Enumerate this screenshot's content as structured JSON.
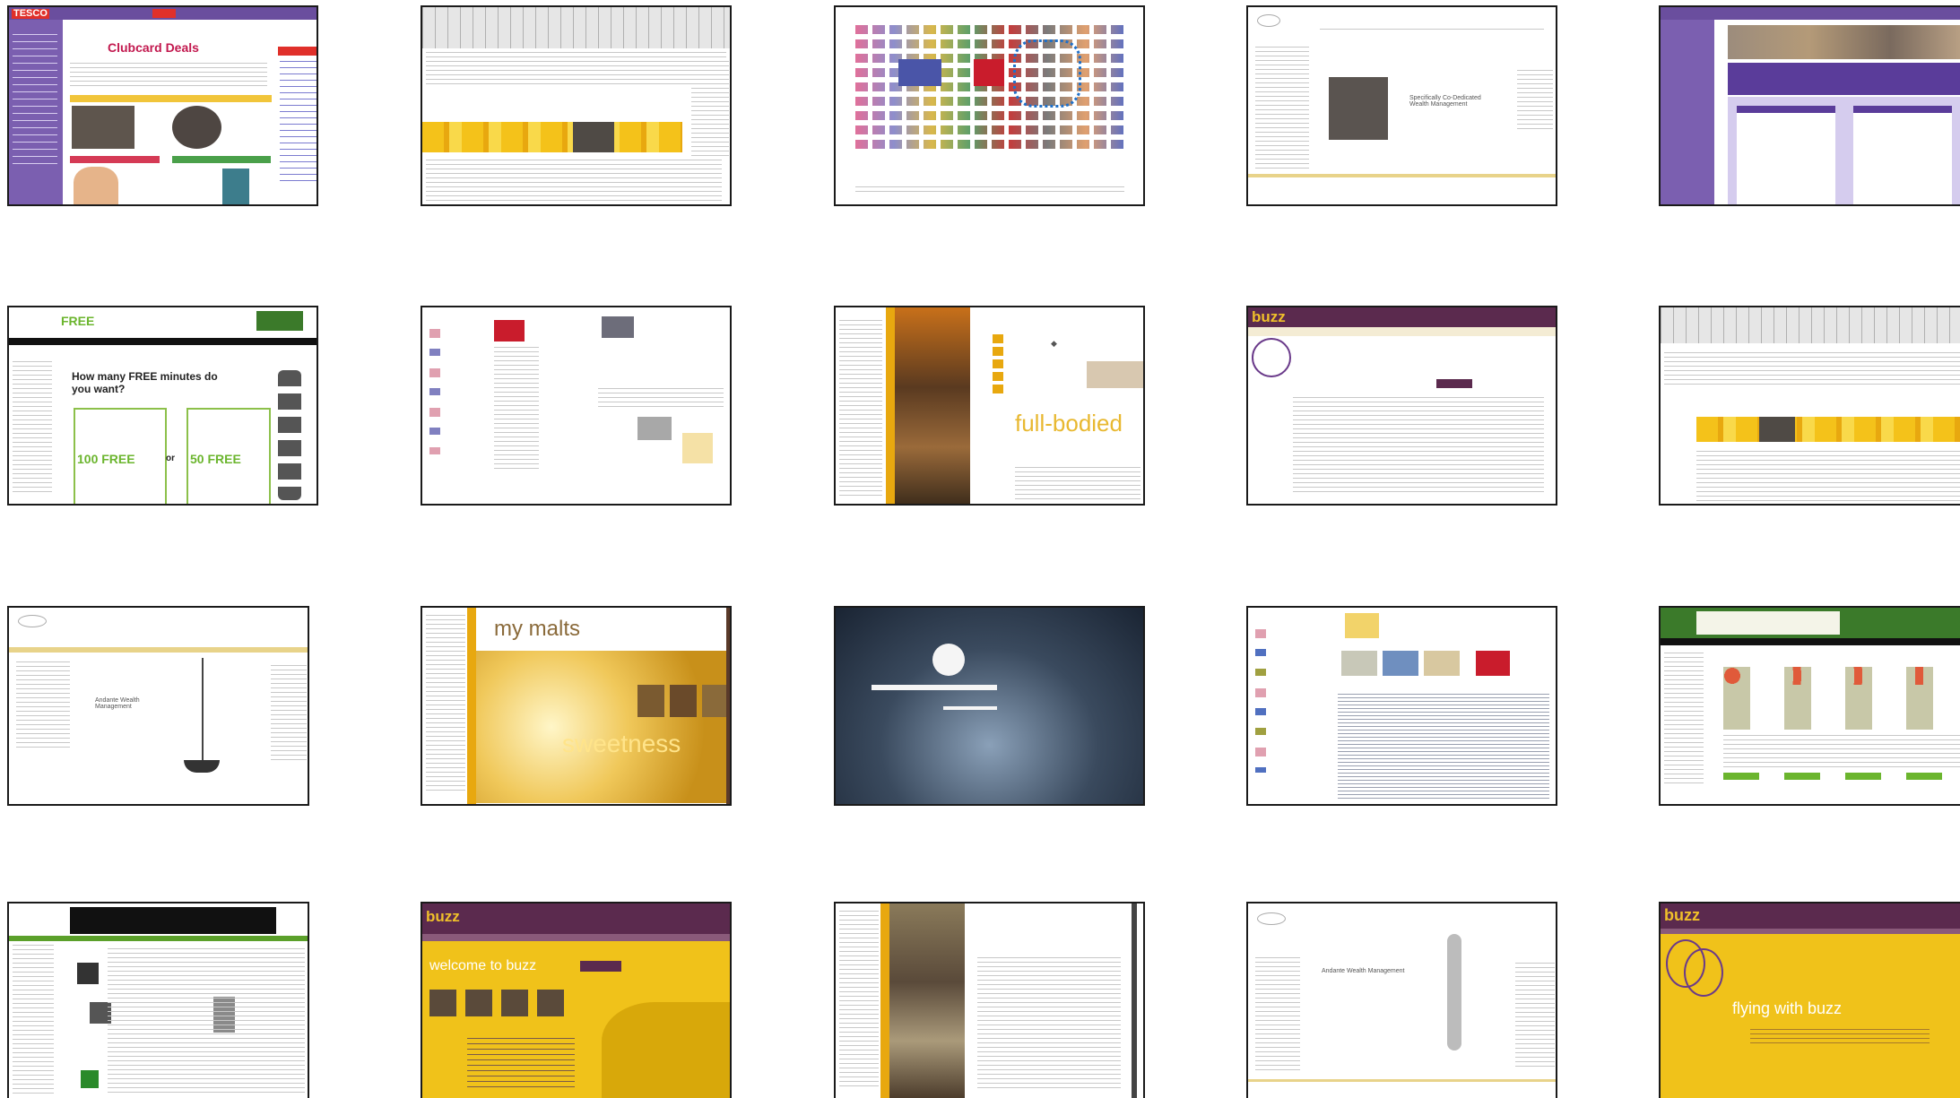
{
  "thumbnails": [
    {
      "texts": {
        "logo": "TESCO",
        "title": "Clubcard Deals"
      }
    },
    {
      "texts": {}
    },
    {
      "texts": {}
    },
    {
      "texts": {
        "headline": "Specifically Co-Dedicated Wealth Management"
      }
    },
    {
      "texts": {}
    },
    {
      "texts": {
        "free": "FREE",
        "headline": "How many FREE minutes do you want?",
        "left_count": "100 FREE",
        "or": "or",
        "right_count": "50 FREE"
      }
    },
    {
      "texts": {}
    },
    {
      "texts": {
        "headline": "full-bodied"
      }
    },
    {
      "texts": {
        "logo": "buzz"
      }
    },
    {
      "texts": {}
    },
    {
      "texts": {
        "headline": "Andante Wealth Management"
      }
    },
    {
      "texts": {
        "headline": "my malts",
        "tagline": "sweetness"
      }
    },
    {
      "texts": {}
    },
    {
      "texts": {}
    },
    {
      "texts": {}
    },
    {
      "texts": {}
    },
    {
      "texts": {
        "logo": "buzz",
        "headline": "welcome to buzz"
      }
    },
    {
      "texts": {}
    },
    {
      "texts": {
        "headline": "Andante Wealth Management"
      }
    },
    {
      "texts": {
        "logo": "buzz",
        "headline": "flying with buzz"
      }
    }
  ]
}
